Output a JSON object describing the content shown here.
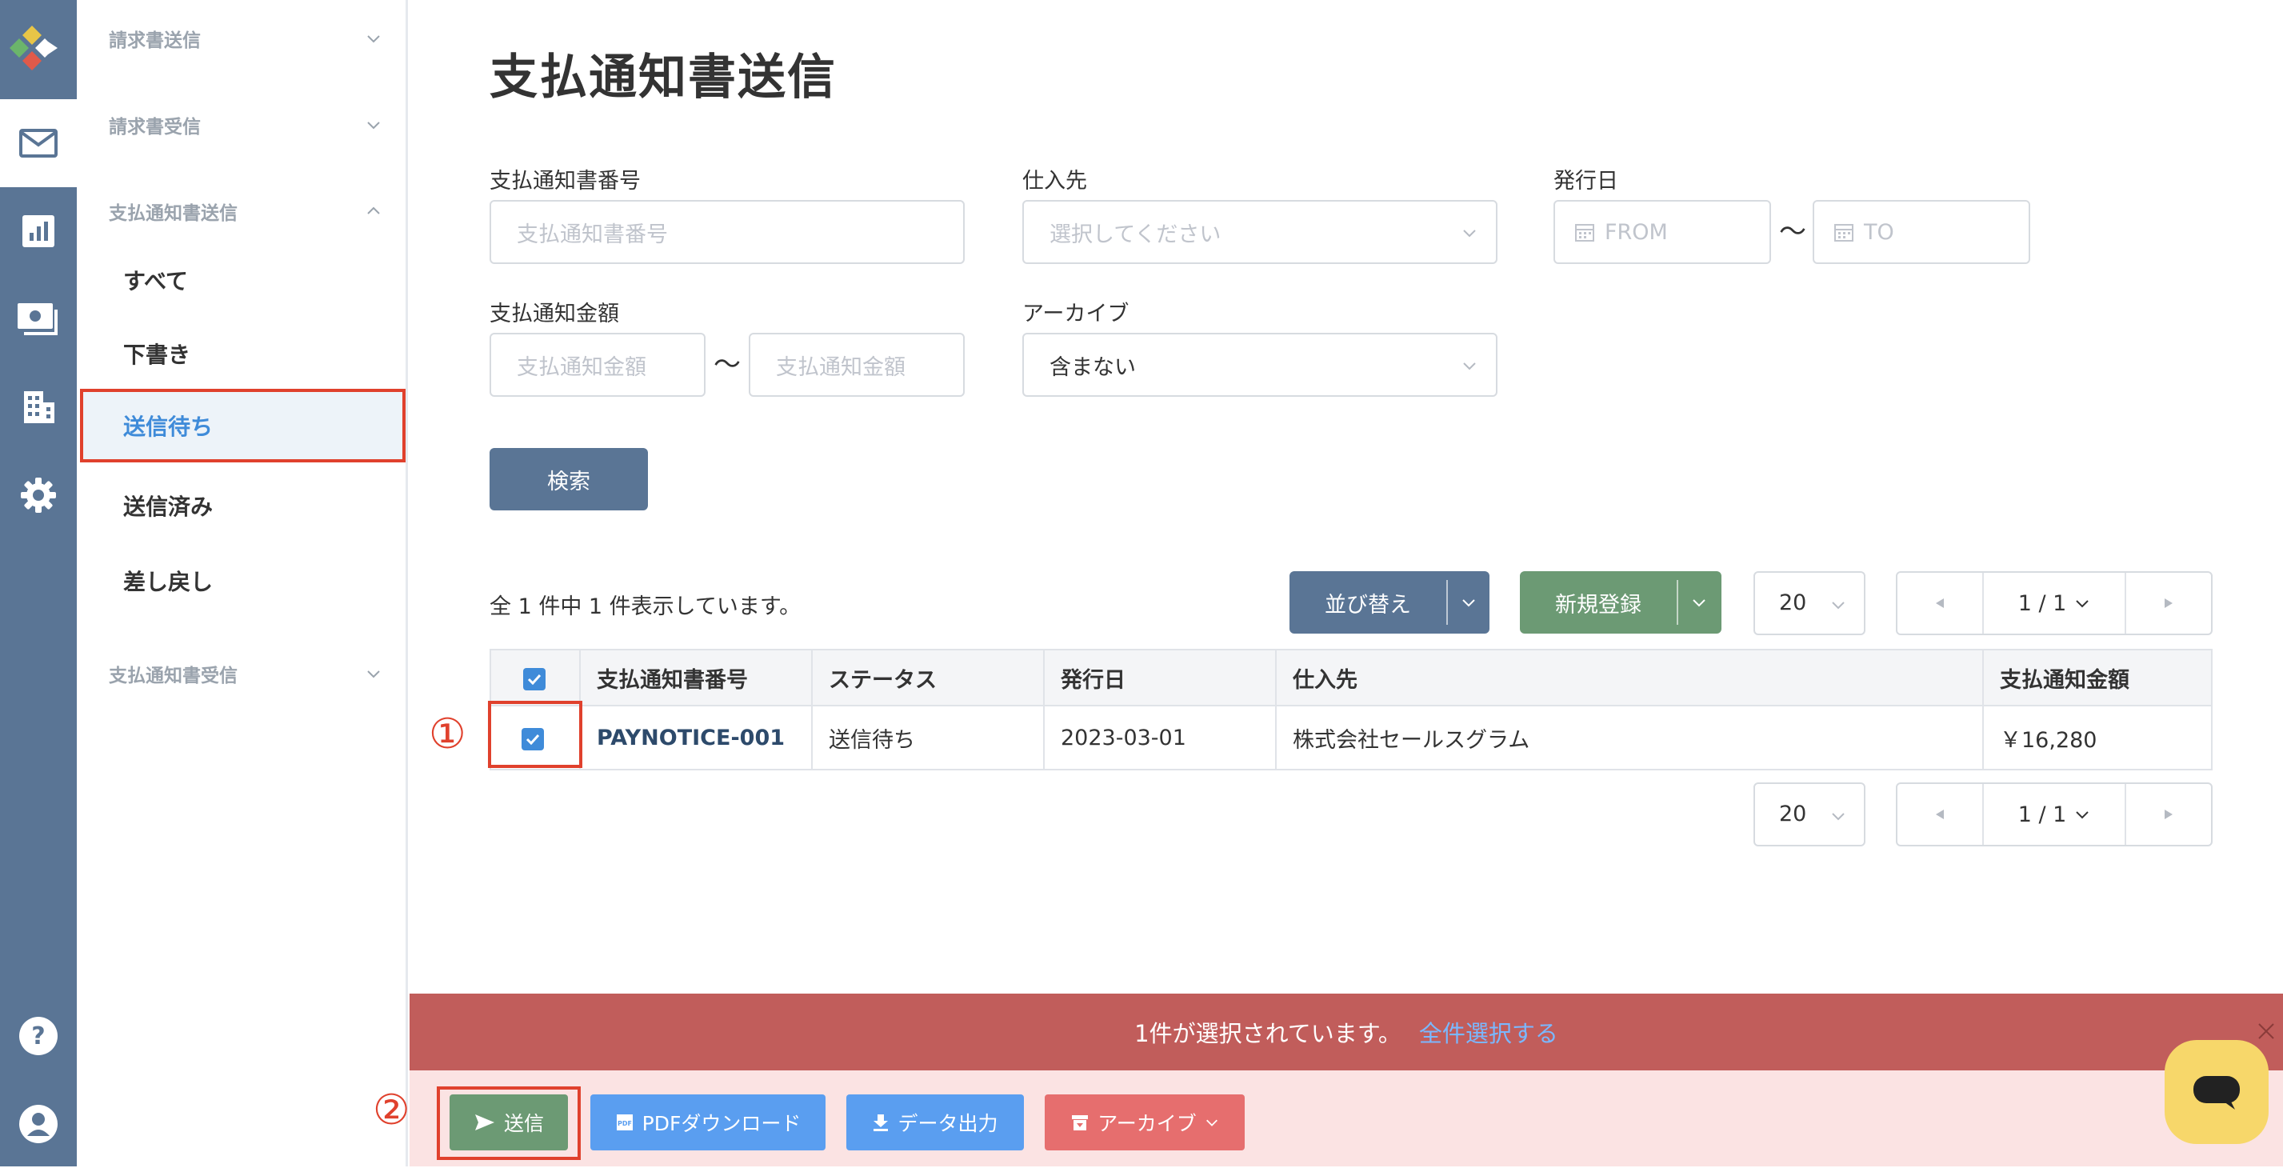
{
  "sidebar": {
    "groups": [
      {
        "label": "請求書送信"
      },
      {
        "label": "請求書受信"
      },
      {
        "label": "支払通知書送信"
      },
      {
        "label": "支払通知書受信"
      }
    ],
    "items": [
      {
        "label": "すべて"
      },
      {
        "label": "下書き"
      },
      {
        "label": "送信待ち"
      },
      {
        "label": "送信済み"
      },
      {
        "label": "差し戻し"
      }
    ],
    "active_item": "送信待ち"
  },
  "page_title": "支払通知書送信",
  "filters": {
    "number": {
      "label": "支払通知書番号",
      "placeholder": "支払通知書番号"
    },
    "supplier": {
      "label": "仕入先",
      "placeholder": "選択してください"
    },
    "issue_date": {
      "label": "発行日",
      "from_placeholder": "FROM",
      "to_placeholder": "TO",
      "separator": "〜"
    },
    "amount": {
      "label": "支払通知金額",
      "min_placeholder": "支払通知金額",
      "max_placeholder": "支払通知金額",
      "separator": "〜"
    },
    "archive": {
      "label": "アーカイブ",
      "value": "含まない"
    },
    "search_button": "検索"
  },
  "results": {
    "count_text": "全 1 件中 1 件表示しています。",
    "sort_button": "並び替え",
    "new_button": "新規登録",
    "per_page": "20",
    "page_indicator": "1 / 1"
  },
  "table": {
    "headers": [
      "支払通知書番号",
      "ステータス",
      "発行日",
      "仕入先",
      "支払通知金額"
    ],
    "rows": [
      {
        "number": "PAYNOTICE-001",
        "status": "送信待ち",
        "issue_date": "2023-03-01",
        "supplier": "株式会社セールスグラム",
        "amount": "￥16,280",
        "checked": true
      }
    ]
  },
  "selection": {
    "text": "1件が選択されています。",
    "select_all": "全件選択する"
  },
  "actions": {
    "send": "送信",
    "pdf": "PDFダウンロード",
    "export": "データ出力",
    "archive": "アーカイブ"
  },
  "annotations": {
    "step1": "①",
    "step2": "②"
  },
  "colors": {
    "rail": "#5a7595",
    "accent_blue": "#3f8bd9",
    "search_button": "#5a7595",
    "sort_button": "#5a7595",
    "new_button": "#6c9a74",
    "send_button": "#6c9a74",
    "pdf_button": "#5a9ef0",
    "export_button": "#5a9ef0",
    "archive_button": "#e66e6e",
    "selection_bar": "#c15d5b",
    "highlight": "#e0412d"
  },
  "icons": {
    "rail": [
      "logo-icon",
      "mail-icon",
      "chart-icon",
      "invoice-icon",
      "building-icon",
      "gear-icon",
      "help-icon",
      "user-icon"
    ],
    "chat": "chat-icon"
  }
}
